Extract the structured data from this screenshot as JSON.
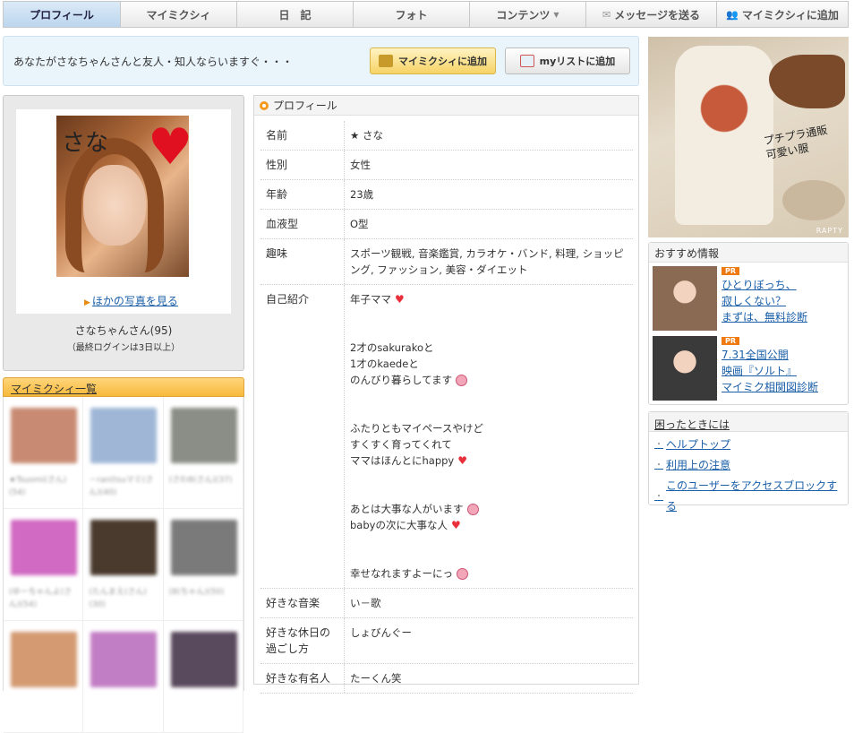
{
  "nav": {
    "tabs": [
      {
        "label": "プロフィール",
        "active": true
      },
      {
        "label": "マイミクシィ"
      },
      {
        "label": "日　記"
      },
      {
        "label": "フォト"
      },
      {
        "label": "コンテンツ"
      },
      {
        "label": "メッセージを送る",
        "icon": "envelope-icon"
      },
      {
        "label": "マイミクシィに追加",
        "icon": "users-icon"
      }
    ]
  },
  "friendbar": {
    "message": "あなたがさなちゃんさんと友人・知人ならいますぐ・・・",
    "add_button": "マイミクシィに追加",
    "mylist_button": "myリストに追加"
  },
  "profile_card": {
    "photo_caption": "さな",
    "more_photos": "ほかの写真を見る",
    "name": "さなちゃんさん(95)",
    "last_login": "（最終ログインは3日以上）"
  },
  "friends": {
    "title": "マイミクシィ一覧",
    "items": [
      {
        "name": "★Tsuomi(さん)(54)",
        "color": "#c88a72"
      },
      {
        "name": "－ran(tsuマミ(さん)(40)",
        "color": "#9fb6d6"
      },
      {
        "name": "(さわ8(さん)(37)",
        "color": "#8b8e86"
      },
      {
        "name": "(ゆーちゃんよ(さん)(54)",
        "color": "#d06ac2"
      },
      {
        "name": "(たんまえ(さん)(30)",
        "color": "#4a3a2e"
      },
      {
        "name": "(8(ちゃん)(50)",
        "color": "#7a7a7a"
      },
      {
        "name": "",
        "color": "#d49a72"
      },
      {
        "name": "",
        "color": "#c27ec4"
      },
      {
        "name": "",
        "color": "#5a4a5e"
      }
    ]
  },
  "profile": {
    "header": "プロフィール",
    "rows": [
      {
        "key": "名前",
        "value": "★ さな"
      },
      {
        "key": "性別",
        "value": "女性"
      },
      {
        "key": "年齢",
        "value": "23歳"
      },
      {
        "key": "血液型",
        "value": "O型"
      },
      {
        "key": "趣味",
        "value": "スポーツ観戦, 音楽鑑賞, カラオケ・バンド, 料理, ショッピング, ファッション, 美容・ダイエット"
      },
      {
        "key": "好きな音楽",
        "value": "い－歌"
      },
      {
        "key": "好きな休日の過ごし方",
        "value": "しょびんぐー"
      },
      {
        "key": "好きな有名人",
        "value": "たーくん笑"
      }
    ],
    "intro_key": "自己紹介",
    "intro_lines": [
      "年子ママ",
      "",
      "",
      "2才のsakurakoと",
      "1才のkaedeと",
      "のんびり暮らしてます",
      "",
      "",
      "ふたりともマイペースやけど",
      "すくすく育ってくれて",
      "ママはほんとにhappy",
      "",
      "",
      "あとは大事な人がいます",
      "babyの次に大事な人",
      "",
      "",
      "幸せなれますよーにっ"
    ]
  },
  "ad": {
    "copy": "プチプラ通販\n可愛い服",
    "brand": "RAPTY"
  },
  "recommend": {
    "title": "おすすめ情報",
    "badge": "PR",
    "items": [
      {
        "lines": [
          "ひとりぼっち、",
          "寂しくない？",
          "まずは、無料診断"
        ],
        "color": "#8a6a52"
      },
      {
        "lines": [
          "7.31全国公開",
          "映画『ソルト』",
          "マイミク相関図診断"
        ],
        "color": "#3a3a3a"
      }
    ]
  },
  "help": {
    "title": "困ったときには",
    "links": [
      "ヘルプトップ",
      "利用上の注意",
      "このユーザーをアクセスブロックする"
    ]
  }
}
